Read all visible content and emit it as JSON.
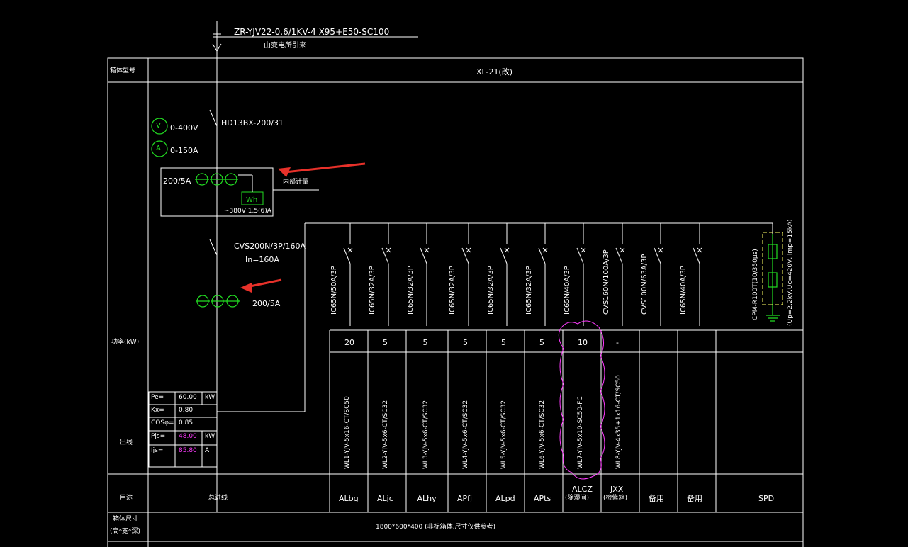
{
  "header": {
    "cable_spec": "ZR-YJV22-0.6/1KV-4 X95+E50-SC100",
    "cable_from": "由变电所引来"
  },
  "cabinet": {
    "type_label": "箱体型号",
    "type_value": "XL-21(改)",
    "power_label": "功率(kW)",
    "outlet_label": "出线",
    "usage_label": "用途",
    "size_label_1": "箱体尺寸",
    "size_label_2": "(高*宽*深)",
    "size_value": "1800*600*400  (非标箱体,尺寸仅供参考)",
    "main_usage": "总进线"
  },
  "incoming": {
    "voltmeter": "V",
    "voltmeter_range": "0-400V",
    "ammeter": "A",
    "ammeter_range": "0-150A",
    "switch": "HD13BX-200/31",
    "ct_ratio": "200/5A",
    "meter_label": "内部计量",
    "wh": "Wh",
    "meter_spec": "~380V 1.5(6)A",
    "breaker": "CVS200N/3P/160A",
    "breaker_in": "In=160A",
    "ct_ratio_2": "200/5A"
  },
  "load_table": {
    "rows": [
      {
        "label": "Pe=",
        "value": "60.00",
        "unit": "kW",
        "highlight": false
      },
      {
        "label": "Kx=",
        "value": "0.80",
        "unit": "",
        "highlight": false
      },
      {
        "label": "COSφ=",
        "value": "0.85",
        "unit": "",
        "highlight": false
      },
      {
        "label": "Pjs=",
        "value": "48.00",
        "unit": "kW",
        "highlight": true
      },
      {
        "label": "Ijs=",
        "value": "85.80",
        "unit": "A",
        "highlight": true
      }
    ]
  },
  "feeders": [
    {
      "breaker": "IC65N/50A/3P",
      "power": "20",
      "cable": "WL1-YJV-5x16-CT/SC50",
      "usage": "ALbg",
      "usage2": ""
    },
    {
      "breaker": "IC65N/32A/3P",
      "power": "5",
      "cable": "WL2-YJV-5x6-CT/SC32",
      "usage": "ALjc",
      "usage2": ""
    },
    {
      "breaker": "IC65N/32A/3P",
      "power": "5",
      "cable": "WL3-YJV-5x6-CT/SC32",
      "usage": "ALhy",
      "usage2": ""
    },
    {
      "breaker": "IC65N/32A/3P",
      "power": "5",
      "cable": "WL4-YJV-5x6-CT/SC32",
      "usage": "APfj",
      "usage2": ""
    },
    {
      "breaker": "IC65N/32A/3P",
      "power": "5",
      "cable": "WL5-YJV-5x6-CT/SC32",
      "usage": "ALpd",
      "usage2": ""
    },
    {
      "breaker": "IC65N/32A/3P",
      "power": "5",
      "cable": "WL6-YJV-5x6-CT/SC32",
      "usage": "APts",
      "usage2": ""
    },
    {
      "breaker": "IC65N/40A/3P",
      "power": "10",
      "cable": "WL7-YJV-5x10-SC50-FC",
      "usage": "ALCZ",
      "usage2": "(除湿间)"
    },
    {
      "breaker": "CVS160N/100A/3P",
      "power": "-",
      "cable": "WL8-YJV-4x35+1x16-CT/SC50",
      "usage": "JXX",
      "usage2": "(检修箱)"
    },
    {
      "breaker": "CVS100N/63A/3P",
      "power": "",
      "cable": "",
      "usage": "备用",
      "usage2": ""
    },
    {
      "breaker": "IC65N/40A/3P",
      "power": "",
      "cable": "",
      "usage": "备用",
      "usage2": ""
    }
  ],
  "spd": {
    "model": "CPM-R100T(10/350μs)",
    "params": "(Up=2.2kV,Uc=420V,Iimp=15kA)",
    "usage": "SPD"
  },
  "colors": {
    "background": "#000000",
    "lines": "#ffffff",
    "symbols": "#22dd22",
    "highlight": "#ff3bff",
    "arrows": "#e8312a",
    "spd_box": "#ffff66"
  }
}
